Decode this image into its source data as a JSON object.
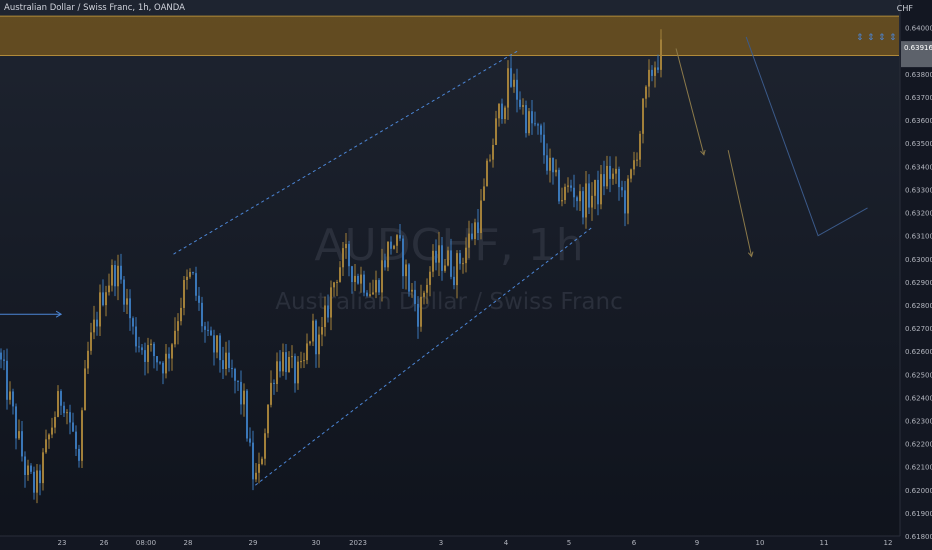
{
  "header": {
    "title": "Australian Dollar / Swiss Franc, 1h, OANDA",
    "currency": "CHF"
  },
  "watermark": {
    "symbol": "AUDCHF, 1h",
    "name": "Australian Dollar / Swiss Franc"
  },
  "colors": {
    "background": "#131722",
    "candle_up": "#a2803a",
    "candle_down": "#3a77b8",
    "zone_fill": "#7a5a1e",
    "zone_border": "#b08a3a",
    "channel_line": "#4c86d6",
    "projection_line": "#8c7a4a",
    "axis_text": "#b2b5be",
    "price_label_bg": "#9aa1a8"
  },
  "chart_data": {
    "type": "candlestick",
    "symbol": "AUDCHF",
    "timeframe": "1h",
    "ylim": [
      0.618,
      0.6412
    ],
    "y_ticks": [
      "0.64100",
      "0.64000",
      "0.63800",
      "0.63700",
      "0.63600",
      "0.63500",
      "0.63400",
      "0.63300",
      "0.63200",
      "0.63100",
      "0.63000",
      "0.62900",
      "0.62800",
      "0.62700",
      "0.62600",
      "0.62500",
      "0.62400",
      "0.62300",
      "0.62200",
      "0.62100",
      "0.62000",
      "0.61900",
      "0.61800"
    ],
    "x_ticks": [
      "23",
      "26",
      "08:00",
      "28",
      "29",
      "30",
      "2023",
      "3",
      "4",
      "5",
      "6",
      "9",
      "10",
      "11",
      "12"
    ],
    "current_price": "0.63916",
    "resistance_zone": [
      0.6388,
      0.6405
    ],
    "price_path": [
      [
        0.0,
        0.6256
      ],
      [
        0.01,
        0.624
      ],
      [
        0.02,
        0.6222
      ],
      [
        0.03,
        0.6206
      ],
      [
        0.04,
        0.62
      ],
      [
        0.05,
        0.6215
      ],
      [
        0.06,
        0.6232
      ],
      [
        0.07,
        0.6242
      ],
      [
        0.08,
        0.6226
      ],
      [
        0.088,
        0.621
      ],
      [
        0.096,
        0.6255
      ],
      [
        0.106,
        0.6272
      ],
      [
        0.116,
        0.6288
      ],
      [
        0.128,
        0.6295
      ],
      [
        0.138,
        0.6287
      ],
      [
        0.148,
        0.6268
      ],
      [
        0.16,
        0.6261
      ],
      [
        0.172,
        0.6258
      ],
      [
        0.184,
        0.6255
      ],
      [
        0.193,
        0.6268
      ],
      [
        0.203,
        0.6285
      ],
      [
        0.213,
        0.6293
      ],
      [
        0.222,
        0.6277
      ],
      [
        0.232,
        0.6262
      ],
      [
        0.242,
        0.626
      ],
      [
        0.252,
        0.6252
      ],
      [
        0.262,
        0.6246
      ],
      [
        0.272,
        0.6236
      ],
      [
        0.28,
        0.6208
      ],
      [
        0.287,
        0.6203
      ],
      [
        0.296,
        0.6232
      ],
      [
        0.306,
        0.6255
      ],
      [
        0.316,
        0.6258
      ],
      [
        0.326,
        0.625
      ],
      [
        0.336,
        0.6249
      ],
      [
        0.346,
        0.627
      ],
      [
        0.356,
        0.6262
      ],
      [
        0.366,
        0.6282
      ],
      [
        0.376,
        0.6297
      ],
      [
        0.386,
        0.63
      ],
      [
        0.396,
        0.6293
      ],
      [
        0.406,
        0.6291
      ],
      [
        0.416,
        0.6285
      ],
      [
        0.426,
        0.6298
      ],
      [
        0.436,
        0.6308
      ],
      [
        0.446,
        0.6302
      ],
      [
        0.456,
        0.6287
      ],
      [
        0.466,
        0.6276
      ],
      [
        0.476,
        0.6293
      ],
      [
        0.486,
        0.63
      ],
      [
        0.496,
        0.63
      ],
      [
        0.506,
        0.6295
      ],
      [
        0.516,
        0.6303
      ],
      [
        0.526,
        0.6312
      ],
      [
        0.536,
        0.6322
      ],
      [
        0.546,
        0.6347
      ],
      [
        0.556,
        0.6364
      ],
      [
        0.566,
        0.6377
      ],
      [
        0.576,
        0.6371
      ],
      [
        0.586,
        0.636
      ],
      [
        0.596,
        0.6356
      ],
      [
        0.606,
        0.6345
      ],
      [
        0.616,
        0.6333
      ],
      [
        0.626,
        0.6327
      ],
      [
        0.636,
        0.6332
      ],
      [
        0.646,
        0.6324
      ],
      [
        0.656,
        0.6327
      ],
      [
        0.666,
        0.6329
      ],
      [
        0.676,
        0.6338
      ],
      [
        0.686,
        0.6333
      ],
      [
        0.696,
        0.6324
      ],
      [
        0.706,
        0.6343
      ],
      [
        0.716,
        0.6365
      ],
      [
        0.726,
        0.6383
      ],
      [
        0.736,
        0.639
      ]
    ],
    "annotations": [
      {
        "type": "channel_line",
        "from": [
          0.193,
          0.6302
        ],
        "to": [
          0.576,
          0.639
        ]
      },
      {
        "type": "channel_line",
        "from": [
          0.284,
          0.6202
        ],
        "to": [
          0.66,
          0.6314
        ]
      },
      {
        "type": "arrow",
        "from": [
          0.0,
          0.6276
        ],
        "to": [
          0.068,
          0.6276
        ]
      },
      {
        "type": "projection_arrow",
        "from": [
          0.752,
          0.6391
        ],
        "to": [
          0.783,
          0.6345
        ]
      },
      {
        "type": "projection_arrow",
        "from": [
          0.81,
          0.6347
        ],
        "to": [
          0.836,
          0.6301
        ]
      },
      {
        "type": "projection_line",
        "points": [
          [
            0.83,
            0.6396
          ],
          [
            0.91,
            0.631
          ],
          [
            0.965,
            0.6322
          ]
        ]
      }
    ]
  }
}
